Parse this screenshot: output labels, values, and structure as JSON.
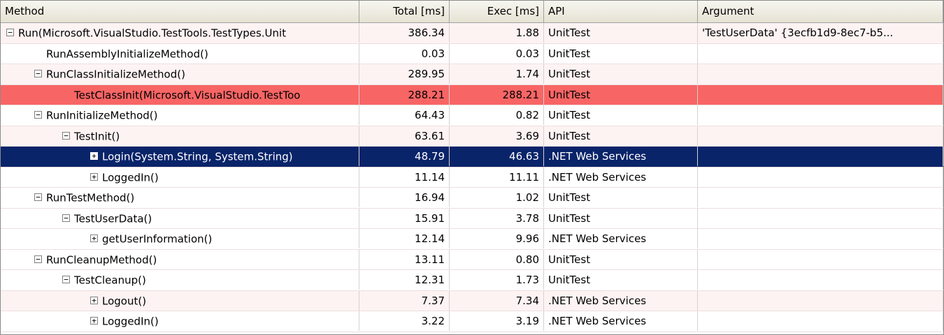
{
  "columns": {
    "method": "Method",
    "total": "Total [ms]",
    "exec": "Exec [ms]",
    "api": "API",
    "argument": "Argument"
  },
  "colors": {
    "header": "#ece9d8",
    "hot_row": "#f86565",
    "selected_row": "#0a246a",
    "alt_row": "#fdf3f3"
  },
  "rows": [
    {
      "method": "Run(Microsoft.VisualStudio.TestTools.TestTypes.Unit",
      "total": "386.34",
      "exec": "1.88",
      "api": "UnitTest",
      "argument": "'TestUserData' {3ecfb1d9-8ec7-b5...",
      "toggle": "⊟",
      "indent": 0,
      "state": "alt"
    },
    {
      "method": "RunAssemblyInitializeMethod()",
      "total": "0.03",
      "exec": "0.03",
      "api": "UnitTest",
      "argument": "",
      "toggle": "",
      "indent": 1,
      "state": ""
    },
    {
      "method": "RunClassInitializeMethod()",
      "total": "289.95",
      "exec": "1.74",
      "api": "UnitTest",
      "argument": "",
      "toggle": "⊟",
      "indent": 1,
      "state": "alt"
    },
    {
      "method": "TestClassInit(Microsoft.VisualStudio.TestToo",
      "total": "288.21",
      "exec": "288.21",
      "api": "UnitTest",
      "argument": "",
      "toggle": "",
      "indent": 2,
      "state": "red"
    },
    {
      "method": "RunInitializeMethod()",
      "total": "64.43",
      "exec": "0.82",
      "api": "UnitTest",
      "argument": "",
      "toggle": "⊟",
      "indent": 1,
      "state": ""
    },
    {
      "method": "TestInit()",
      "total": "63.61",
      "exec": "3.69",
      "api": "UnitTest",
      "argument": "",
      "toggle": "⊟",
      "indent": 2,
      "state": "alt"
    },
    {
      "method": "Login(System.String, System.String)",
      "total": "48.79",
      "exec": "46.63",
      "api": ".NET Web Services",
      "argument": "",
      "toggle": "⊞",
      "indent": 3,
      "state": "sel"
    },
    {
      "method": "LoggedIn()",
      "total": "11.14",
      "exec": "11.11",
      "api": ".NET Web Services",
      "argument": "",
      "toggle": "⊞",
      "indent": 3,
      "state": ""
    },
    {
      "method": "RunTestMethod()",
      "total": "16.94",
      "exec": "1.02",
      "api": "UnitTest",
      "argument": "",
      "toggle": "⊟",
      "indent": 1,
      "state": ""
    },
    {
      "method": "TestUserData()",
      "total": "15.91",
      "exec": "3.78",
      "api": "UnitTest",
      "argument": "",
      "toggle": "⊟",
      "indent": 2,
      "state": ""
    },
    {
      "method": "getUserInformation()",
      "total": "12.14",
      "exec": "9.96",
      "api": ".NET Web Services",
      "argument": "",
      "toggle": "⊞",
      "indent": 3,
      "state": ""
    },
    {
      "method": "RunCleanupMethod()",
      "total": "13.11",
      "exec": "0.80",
      "api": "UnitTest",
      "argument": "",
      "toggle": "⊟",
      "indent": 1,
      "state": ""
    },
    {
      "method": "TestCleanup()",
      "total": "12.31",
      "exec": "1.73",
      "api": "UnitTest",
      "argument": "",
      "toggle": "⊟",
      "indent": 2,
      "state": ""
    },
    {
      "method": "Logout()",
      "total": "7.37",
      "exec": "7.34",
      "api": ".NET Web Services",
      "argument": "",
      "toggle": "⊞",
      "indent": 3,
      "state": "alt"
    },
    {
      "method": "LoggedIn()",
      "total": "3.22",
      "exec": "3.19",
      "api": ".NET Web Services",
      "argument": "",
      "toggle": "⊞",
      "indent": 3,
      "state": ""
    }
  ]
}
